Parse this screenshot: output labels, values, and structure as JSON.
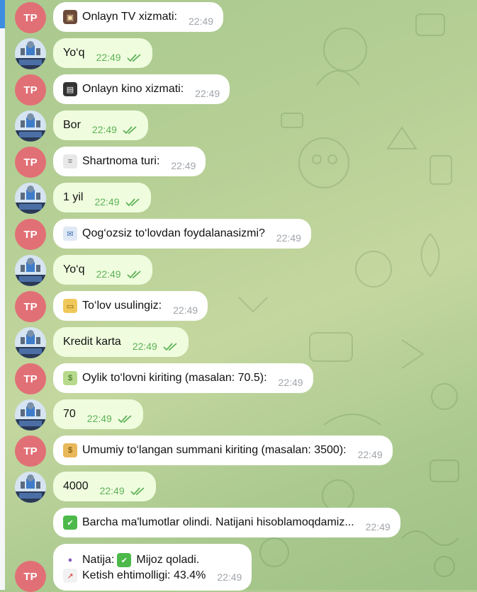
{
  "sender_initials": "TP",
  "colors": {
    "incoming_bubble": "#ffffff",
    "outgoing_bubble": "#effdde",
    "avatar_tp": "#e17076",
    "read_check": "#5fb159",
    "accent": "#3d8ee0"
  },
  "messages": [
    {
      "from": "bot",
      "icon": "tv-icon",
      "text": "Onlayn TV xizmati:",
      "time": "22:49"
    },
    {
      "from": "user",
      "text": "Yo‘q",
      "time": "22:49"
    },
    {
      "from": "bot",
      "icon": "clapper-icon",
      "text": "Onlayn kino xizmati:",
      "time": "22:49"
    },
    {
      "from": "user",
      "text": "Bor",
      "time": "22:49"
    },
    {
      "from": "bot",
      "icon": "document-icon",
      "text": "Shartnoma turi:",
      "time": "22:49"
    },
    {
      "from": "user",
      "text": "1 yil",
      "time": "22:49"
    },
    {
      "from": "bot",
      "icon": "email-icon",
      "text": "Qog‘ozsiz to‘lovdan foydalanasizmi?",
      "time": "22:49"
    },
    {
      "from": "user",
      "text": "Yo‘q",
      "time": "22:49"
    },
    {
      "from": "bot",
      "icon": "credit-card-icon",
      "text": "To‘lov usulingiz:",
      "time": "22:49"
    },
    {
      "from": "user",
      "text": "Kredit karta",
      "time": "22:49"
    },
    {
      "from": "bot",
      "icon": "dollar-banknote-icon",
      "text": "Oylik to‘lovni kiriting (masalan: 70.5):",
      "time": "22:49"
    },
    {
      "from": "user",
      "text": "70",
      "time": "22:49"
    },
    {
      "from": "bot",
      "icon": "money-bag-icon",
      "text": "Umumiy to‘langan summani kiriting (masalan: 3500):",
      "time": "22:49"
    },
    {
      "from": "user",
      "text": "4000",
      "time": "22:49"
    },
    {
      "from": "bot",
      "icon": "check-mark-icon",
      "text": "Barcha ma'lumotlar olindi. Natijani hisoblamoqdamiz...",
      "time": "22:49"
    },
    {
      "from": "bot",
      "line1_icon": "crystal-ball-icon",
      "line1_text": "Natija:",
      "line1_icon2": "check-mark-icon",
      "line1_text2": "Mijoz qoladi.",
      "line2_icon": "chart-icon",
      "line2_text": "Ketish ehtimolligi: 43.4%",
      "time": "22:49"
    }
  ]
}
